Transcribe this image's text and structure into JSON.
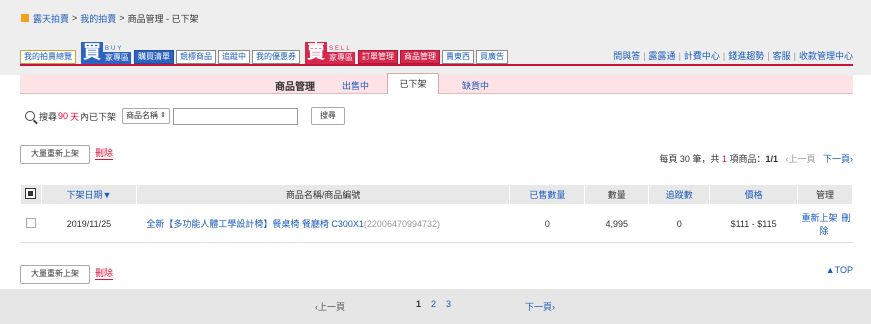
{
  "breadcrumb": {
    "items": [
      "露天拍賣",
      "我的拍賣",
      "商品管理 - 已下架"
    ],
    "sep": ">"
  },
  "top_tabs": {
    "overview": "我的拍賣總覽",
    "buy_brand": {
      "char": "買",
      "en": "BUY",
      "label": "家專區"
    },
    "buy_tabs": [
      "購買清單",
      "競標商品",
      "追蹤中",
      "我的優惠券"
    ],
    "sell_brand": {
      "char": "賣",
      "en": "SELL",
      "label": "家專區"
    },
    "sell_tabs": [
      "訂單管理",
      "商品管理",
      "賣東西",
      "買廣告"
    ]
  },
  "top_links": [
    "問與答",
    "露露通",
    "計費中心",
    "錢進趨勢",
    "客服",
    "收款管理中心"
  ],
  "subnav": {
    "title": "商品管理",
    "items": [
      "出售中",
      "已下架",
      "缺貨中"
    ]
  },
  "search": {
    "prefix": "搜尋",
    "days": "90",
    "days_unit": "天",
    "suffix": "內已下架",
    "field_select": "商品名稱",
    "input_value": "",
    "button": "搜尋"
  },
  "actions": {
    "relist_button": "大量重新上架",
    "delete_link": "刪除"
  },
  "pager_info": {
    "per_page_prefix": "每頁",
    "per_page": "30",
    "per_page_unit": "筆，共",
    "total": "1",
    "total_unit": "項商品：",
    "page": "1/1",
    "prev": "‹上一頁",
    "next": "下一頁›"
  },
  "table": {
    "headers": {
      "date": "下架日期▼",
      "name": "商品名稱/商品編號",
      "sold": "已售數量",
      "qty": "數量",
      "track": "追蹤數",
      "price": "價格",
      "manage": "管理"
    },
    "rows": [
      {
        "date": "2019/11/25",
        "name": "全新【多功能人體工學設計椅】餐桌椅 餐廳椅 C300X1",
        "code": "(22006470994732)",
        "sold": "0",
        "qty": "4,995",
        "track": "0",
        "price": "$111 - $115",
        "relist": "重新上架",
        "delete": "刪除"
      }
    ]
  },
  "to_top": "▲TOP",
  "footer": {
    "prev": "‹上一頁",
    "pages": [
      "1",
      "2",
      "3"
    ],
    "current": "1",
    "next": "下一頁›"
  },
  "colors": {
    "accent_red": "#c8143c",
    "link_blue": "#1a5bbd",
    "pink_bg": "#fde3e6"
  }
}
